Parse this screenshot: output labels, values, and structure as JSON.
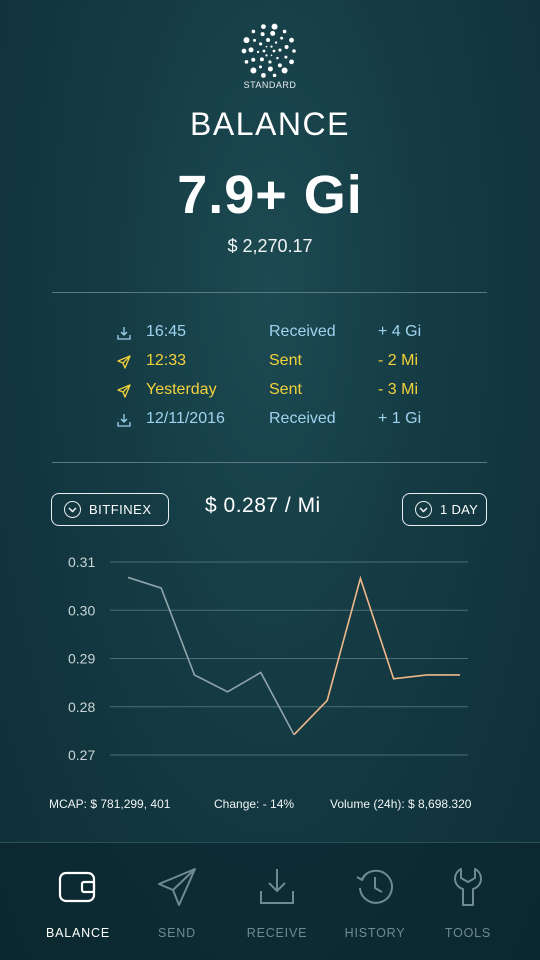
{
  "header": {
    "logo_label": "STANDARD",
    "title": "BALANCE",
    "amount": "7.9+ Gi",
    "usd_value": "$ 2,270.17"
  },
  "transactions": [
    {
      "icon": "receive-icon",
      "time": "16:45",
      "type": "Received",
      "amount": "+ 4 Gi",
      "color": "#9fd3ee"
    },
    {
      "icon": "send-icon",
      "time": "12:33",
      "type": "Sent",
      "amount": "- 2 Mi",
      "color": "#f2d23a"
    },
    {
      "icon": "send-icon",
      "time": "Yesterday",
      "type": "Sent",
      "amount": "- 3 Mi",
      "color": "#f2d23a"
    },
    {
      "icon": "receive-icon",
      "time": "12/11/2016",
      "type": "Received",
      "amount": "+ 1 Gi",
      "color": "#9fd3ee"
    }
  ],
  "market": {
    "exchange": "BITFINEX",
    "price": "$ 0.287 / Mi",
    "timeframe": "1 DAY"
  },
  "chart_data": {
    "type": "line",
    "ylim": [
      0.265,
      0.315
    ],
    "yticks": [
      "0.31",
      "0.30",
      "0.29",
      "0.28",
      "0.27"
    ],
    "ytick_values": [
      0.31,
      0.3,
      0.29,
      0.28,
      0.27
    ],
    "series": [
      {
        "color": "#8fa5aa",
        "x": [
          0,
          1,
          2,
          3,
          4,
          5
        ],
        "values": [
          0.3068,
          0.3046,
          0.2866,
          0.2831,
          0.2871,
          0.2742
        ]
      },
      {
        "color": "#f0b98a",
        "x": [
          5,
          6,
          7,
          8,
          9,
          10
        ],
        "values": [
          0.2742,
          0.2813,
          0.3066,
          0.2858,
          0.2866,
          0.2866
        ]
      }
    ],
    "x_points": [
      0,
      1,
      2,
      3,
      4,
      5,
      6,
      7,
      8,
      9,
      10
    ],
    "xlim": [
      0,
      10
    ],
    "grid": true
  },
  "stats": {
    "mcap": "MCAP: $ 781,299, 401",
    "change": "Change: - 14%",
    "volume": "Volume (24h): $ 8,698.320"
  },
  "nav": [
    {
      "label": "BALANCE",
      "icon": "wallet-icon",
      "active": true
    },
    {
      "label": "SEND",
      "icon": "paper-plane-icon",
      "active": false
    },
    {
      "label": "RECEIVE",
      "icon": "download-icon",
      "active": false
    },
    {
      "label": "HISTORY",
      "icon": "history-icon",
      "active": false
    },
    {
      "label": "TOOLS",
      "icon": "wrench-icon",
      "active": false
    }
  ]
}
